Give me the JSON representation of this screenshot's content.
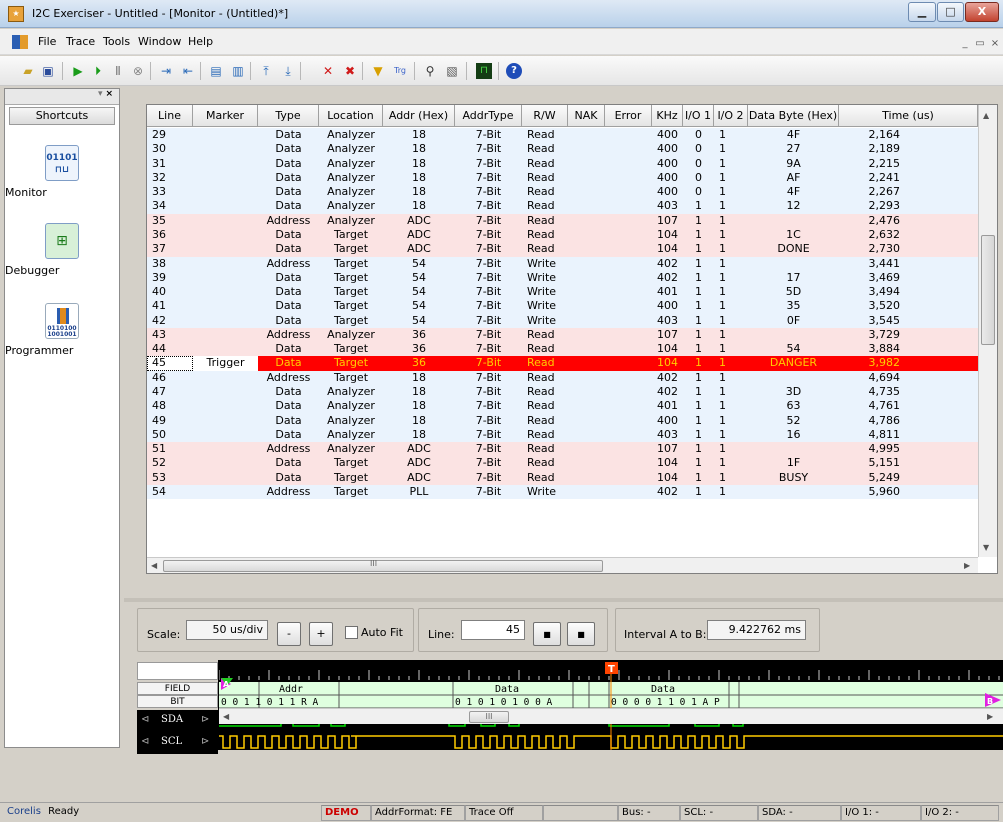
{
  "window": {
    "title": "I2C Exerciser - Untitled - [Monitor - (Untitled)*]"
  },
  "menu": [
    {
      "label": "File",
      "key": "F"
    },
    {
      "label": "Trace",
      "key": "T"
    },
    {
      "label": "Tools",
      "key": "o"
    },
    {
      "label": "Window",
      "key": "W"
    },
    {
      "label": "Help",
      "key": "H"
    }
  ],
  "shortcuts": {
    "title": "Shortcuts",
    "items": [
      {
        "label": "Monitor",
        "icon": "monitor-icon"
      },
      {
        "label": "Debugger",
        "icon": "debugger-icon"
      },
      {
        "label": "Programmer",
        "icon": "programmer-icon"
      }
    ]
  },
  "table": {
    "columns": [
      "Line",
      "Marker",
      "Type",
      "Location",
      "Addr (Hex)",
      "AddrType",
      "R/W",
      "NAK",
      "Error",
      "KHz",
      "I/O 1",
      "I/O 2",
      "Data Byte (Hex)",
      "Time (us)"
    ],
    "rows": [
      [
        "29",
        "",
        "Data",
        "Analyzer",
        "18",
        "7-Bit",
        "Read",
        "",
        "",
        "400",
        "0",
        "1",
        "4F",
        "2,164"
      ],
      [
        "30",
        "",
        "Data",
        "Analyzer",
        "18",
        "7-Bit",
        "Read",
        "",
        "",
        "400",
        "0",
        "1",
        "27",
        "2,189"
      ],
      [
        "31",
        "",
        "Data",
        "Analyzer",
        "18",
        "7-Bit",
        "Read",
        "",
        "",
        "400",
        "0",
        "1",
        "9A",
        "2,215"
      ],
      [
        "32",
        "",
        "Data",
        "Analyzer",
        "18",
        "7-Bit",
        "Read",
        "",
        "",
        "400",
        "0",
        "1",
        "AF",
        "2,241"
      ],
      [
        "33",
        "",
        "Data",
        "Analyzer",
        "18",
        "7-Bit",
        "Read",
        "",
        "",
        "400",
        "0",
        "1",
        "4F",
        "2,267"
      ],
      [
        "34",
        "",
        "Data",
        "Analyzer",
        "18",
        "7-Bit",
        "Read",
        "",
        "",
        "403",
        "1",
        "1",
        "12",
        "2,293"
      ],
      [
        "35",
        "",
        "Address",
        "Analyzer",
        "ADC",
        "7-Bit",
        "Read",
        "",
        "",
        "107",
        "1",
        "1",
        "",
        "2,476"
      ],
      [
        "36",
        "",
        "Data",
        "Target",
        "ADC",
        "7-Bit",
        "Read",
        "",
        "",
        "104",
        "1",
        "1",
        "1C",
        "2,632"
      ],
      [
        "37",
        "",
        "Data",
        "Target",
        "ADC",
        "7-Bit",
        "Read",
        "",
        "",
        "104",
        "1",
        "1",
        "DONE",
        "2,730"
      ],
      [
        "38",
        "",
        "Address",
        "Target",
        "54",
        "7-Bit",
        "Write",
        "",
        "",
        "402",
        "1",
        "1",
        "",
        "3,441"
      ],
      [
        "39",
        "",
        "Data",
        "Target",
        "54",
        "7-Bit",
        "Write",
        "",
        "",
        "402",
        "1",
        "1",
        "17",
        "3,469"
      ],
      [
        "40",
        "",
        "Data",
        "Target",
        "54",
        "7-Bit",
        "Write",
        "",
        "",
        "401",
        "1",
        "1",
        "5D",
        "3,494"
      ],
      [
        "41",
        "",
        "Data",
        "Target",
        "54",
        "7-Bit",
        "Write",
        "",
        "",
        "400",
        "1",
        "1",
        "35",
        "3,520"
      ],
      [
        "42",
        "",
        "Data",
        "Target",
        "54",
        "7-Bit",
        "Write",
        "",
        "",
        "403",
        "1",
        "1",
        "0F",
        "3,545"
      ],
      [
        "43",
        "",
        "Address",
        "Analyzer",
        "36",
        "7-Bit",
        "Read",
        "",
        "",
        "107",
        "1",
        "1",
        "",
        "3,729"
      ],
      [
        "44",
        "",
        "Data",
        "Target",
        "36",
        "7-Bit",
        "Read",
        "",
        "",
        "104",
        "1",
        "1",
        "54",
        "3,884"
      ],
      [
        "45",
        "Trigger",
        "Data",
        "Target",
        "36",
        "7-Bit",
        "Read",
        "",
        "",
        "104",
        "1",
        "1",
        "DANGER",
        "3,982"
      ],
      [
        "46",
        "",
        "Address",
        "Target",
        "18",
        "7-Bit",
        "Read",
        "",
        "",
        "402",
        "1",
        "1",
        "",
        "4,694"
      ],
      [
        "47",
        "",
        "Data",
        "Analyzer",
        "18",
        "7-Bit",
        "Read",
        "",
        "",
        "402",
        "1",
        "1",
        "3D",
        "4,735"
      ],
      [
        "48",
        "",
        "Data",
        "Analyzer",
        "18",
        "7-Bit",
        "Read",
        "",
        "",
        "401",
        "1",
        "1",
        "63",
        "4,761"
      ],
      [
        "49",
        "",
        "Data",
        "Analyzer",
        "18",
        "7-Bit",
        "Read",
        "",
        "",
        "400",
        "1",
        "1",
        "52",
        "4,786"
      ],
      [
        "50",
        "",
        "Data",
        "Analyzer",
        "18",
        "7-Bit",
        "Read",
        "",
        "",
        "403",
        "1",
        "1",
        "16",
        "4,811"
      ],
      [
        "51",
        "",
        "Address",
        "Analyzer",
        "ADC",
        "7-Bit",
        "Read",
        "",
        "",
        "107",
        "1",
        "1",
        "",
        "4,995"
      ],
      [
        "52",
        "",
        "Data",
        "Target",
        "ADC",
        "7-Bit",
        "Read",
        "",
        "",
        "104",
        "1",
        "1",
        "1F",
        "5,151"
      ],
      [
        "53",
        "",
        "Data",
        "Target",
        "ADC",
        "7-Bit",
        "Read",
        "",
        "",
        "104",
        "1",
        "1",
        "BUSY",
        "5,249"
      ],
      [
        "54",
        "",
        "Address",
        "Target",
        "PLL",
        "7-Bit",
        "Write",
        "",
        "",
        "402",
        "1",
        "1",
        "",
        "5,960"
      ]
    ],
    "row_styles": [
      "blue",
      "blue",
      "blue",
      "blue",
      "blue",
      "blue",
      "pink",
      "pink",
      "pink",
      "blue",
      "blue",
      "blue",
      "blue",
      "blue",
      "pink",
      "pink",
      "trigger",
      "blue",
      "blue",
      "blue",
      "blue",
      "blue",
      "pink",
      "pink",
      "pink",
      "blue"
    ],
    "scroll_dots": "III"
  },
  "controls": {
    "scale_label": "Scale:",
    "scale_value": "50 us/div",
    "minus_label": "-",
    "plus_label": "+",
    "autofit_label": "Auto Fit",
    "line_label": "Line:",
    "line_value": "45",
    "interval_label": "Interval A to B:",
    "interval_value": "9.422762 ms"
  },
  "waveform": {
    "field_label": "FIELD",
    "bit_label": "BIT",
    "sda_label": "SDA",
    "scl_label": "SCL",
    "fields": [
      "Addr",
      "Data",
      "Data"
    ],
    "bits": [
      "0 0 1 1 0 1 1 R A",
      "0 1 0 1 0 1 0 0 A",
      "0 0 0 0 1 1 0 1 A P"
    ],
    "markers": [
      "A",
      "T",
      "B"
    ],
    "scroll_dots": "III"
  },
  "status": {
    "company": "Corelis",
    "state": "Ready",
    "demo": "DEMO",
    "addr_format": "AddrFormat: FE",
    "trace": "Trace Off",
    "bus": "Bus: -",
    "scl": "SCL: -",
    "sda": "SDA: -",
    "io1": "I/O 1: -",
    "io2": "I/O 2: -"
  },
  "colors": {
    "row_blue": "#eaf3fd",
    "row_pink": "#fbe3e3",
    "trigger_row": "#ff0000",
    "trigger_text": "#ffcc00",
    "wave_bg": "#000000",
    "wave_signal": "#00dd00",
    "scl_signal": "#ffcc00",
    "decode_bg": "#dfffdf",
    "demo_text": "#cc0000"
  }
}
